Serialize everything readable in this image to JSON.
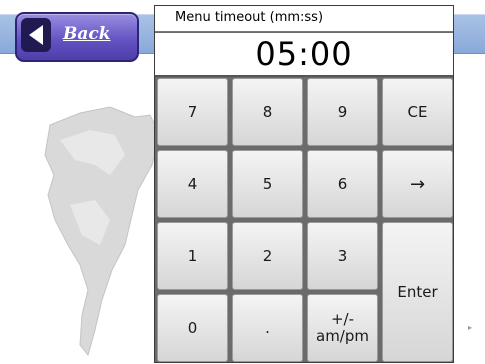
{
  "back_button": {
    "label": "Back"
  },
  "dialog": {
    "caption": "Menu timeout (mm:ss)",
    "value": "05:00"
  },
  "keypad": {
    "row1": [
      "7",
      "8",
      "9",
      "CE"
    ],
    "row2": [
      "4",
      "5",
      "6",
      "→"
    ],
    "row3": [
      "1",
      "2",
      "3"
    ],
    "row4": [
      "0",
      ".",
      "+/-\nam/pm"
    ],
    "enter": "Enter"
  },
  "colors": {
    "topbar": "#89a9d8",
    "back_button": "#6454c4",
    "dialog_frame": "#6b6b6b",
    "key_face": "#e6e6e6"
  },
  "icons": {
    "back": "left-arrow-icon",
    "map": "world-map-watermark"
  }
}
